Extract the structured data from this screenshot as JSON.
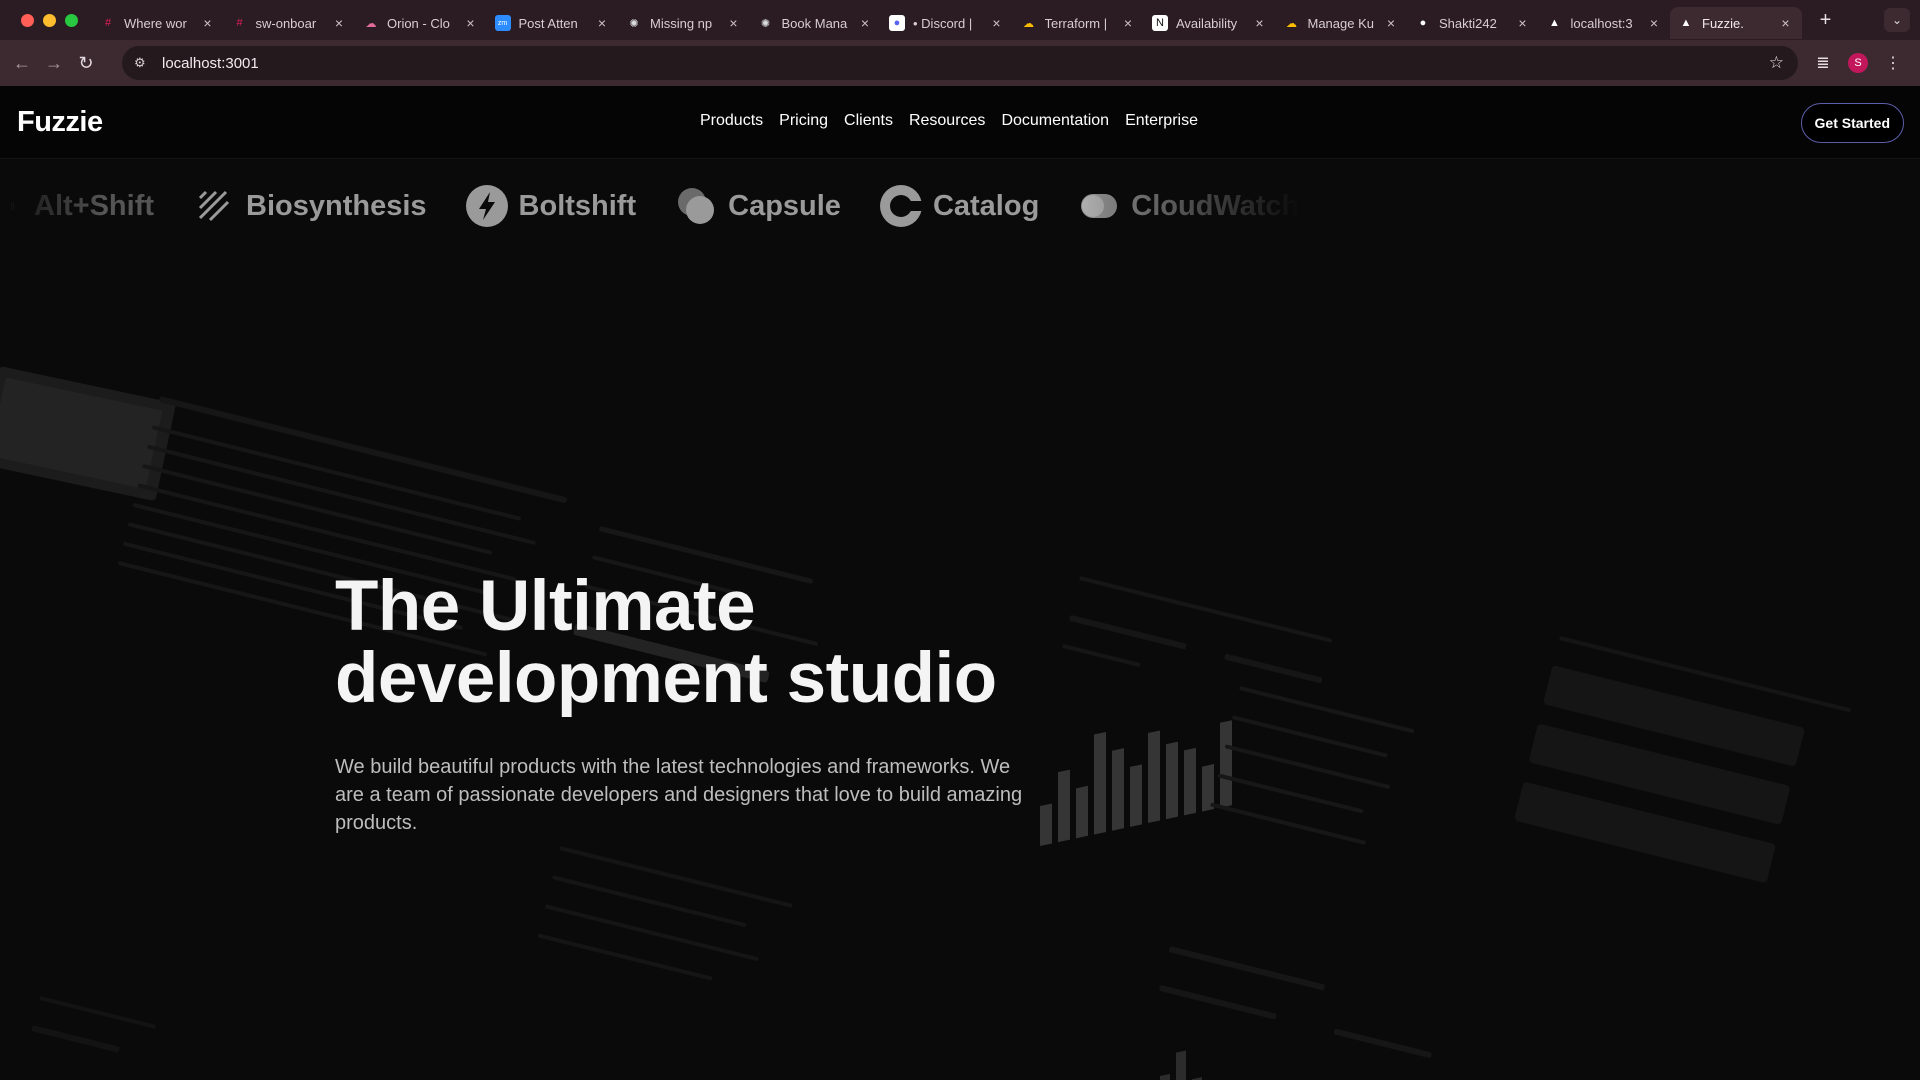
{
  "browser": {
    "tabs": [
      {
        "label": "Where wor",
        "icon": "slack-icon",
        "active": false
      },
      {
        "label": "sw-onboar",
        "icon": "slack-icon",
        "active": false
      },
      {
        "label": "Orion - Clo",
        "icon": "cloud-icon",
        "active": false
      },
      {
        "label": "Post Atten",
        "icon": "zoom-icon",
        "active": false
      },
      {
        "label": "Missing np",
        "icon": "openai-icon",
        "active": false
      },
      {
        "label": "Book Mana",
        "icon": "openai-icon",
        "active": false
      },
      {
        "label": "• Discord |",
        "icon": "discord-icon",
        "active": false
      },
      {
        "label": "Terraform |",
        "icon": "gcloud-icon",
        "active": false
      },
      {
        "label": "Availability",
        "icon": "notion-icon",
        "active": false
      },
      {
        "label": "Manage Ku",
        "icon": "gcloud-icon",
        "active": false
      },
      {
        "label": "Shakti242",
        "icon": "github-icon",
        "active": false
      },
      {
        "label": "localhost:3",
        "icon": "vercel-icon",
        "active": false
      },
      {
        "label": "Fuzzie.",
        "icon": "vercel-icon",
        "active": true
      }
    ],
    "url": "localhost:3001",
    "profile_initial": "S"
  },
  "site": {
    "logo": "Fuzzie",
    "nav": [
      "Products",
      "Pricing",
      "Clients",
      "Resources",
      "Documentation",
      "Enterprise"
    ],
    "cta": "Get Started",
    "client_logos": [
      "Alt+Shift",
      "Biosynthesis",
      "Boltshift",
      "Capsule",
      "Catalog",
      "CloudWatch"
    ],
    "hero_title_line1": "The Ultimate",
    "hero_title_line2": "development studio",
    "hero_subtitle": "We build beautiful products with the latest technologies and frameworks. We are a team of passionate developers and designers that love to build amazing products."
  },
  "colors": {
    "tabbar": "#2a1c22",
    "toolbar": "#3d2a31",
    "page_bg": "#0a0a0a",
    "cta_border": "#5b5ea8"
  }
}
